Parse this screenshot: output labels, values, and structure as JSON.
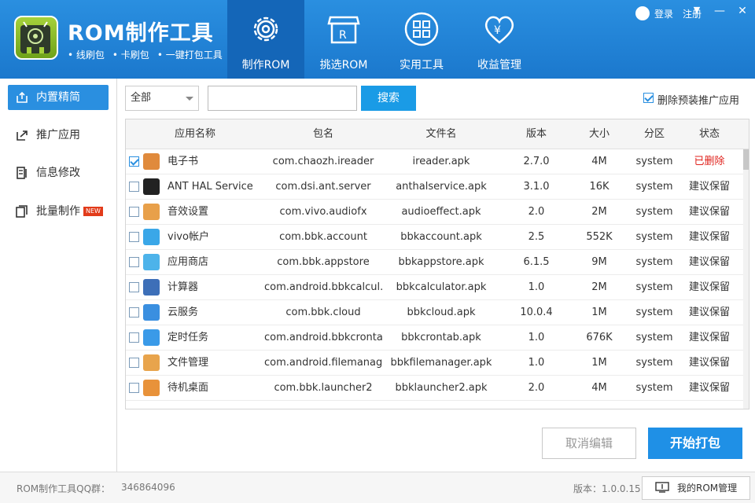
{
  "app": {
    "title": "ROM制作工具",
    "subtitle_items": [
      "• 线刷包",
      "• 卡刷包",
      "• 一键打包工具"
    ]
  },
  "nav": [
    {
      "label": "制作ROM",
      "icon": "gear-icon",
      "active": true
    },
    {
      "label": "挑选ROM",
      "icon": "shop-r-icon",
      "active": false
    },
    {
      "label": "实用工具",
      "icon": "grid-tools-icon",
      "active": false
    },
    {
      "label": "收益管理",
      "icon": "heart-yen-icon",
      "active": false
    }
  ],
  "user": {
    "login": "登录",
    "register": "注册",
    "icon": "user-icon"
  },
  "window_controls": {
    "menu": "▼",
    "minimize": "—",
    "close": "✕"
  },
  "sidebar": {
    "items": [
      {
        "label": "内置精简",
        "icon": "upload-box-icon",
        "active": true
      },
      {
        "label": "推广应用",
        "icon": "share-icon",
        "active": false
      },
      {
        "label": "信息修改",
        "icon": "edit-doc-icon",
        "active": false
      },
      {
        "label": "批量制作",
        "icon": "layers-icon",
        "active": false,
        "badge": "NEW"
      }
    ]
  },
  "toolbar": {
    "filter_value": "全部",
    "search_value": "",
    "search_label": "搜索",
    "remove_preinstalled_label": "删除预装推广应用",
    "remove_preinstalled_checked": true
  },
  "table": {
    "headers": [
      "应用名称",
      "包名",
      "文件名",
      "版本",
      "大小",
      "分区",
      "状态"
    ],
    "rows": [
      {
        "checked": true,
        "icon": "ebook-app-icon",
        "color": "#e08a3c",
        "name": "电子书",
        "package": "com.chaozh.ireader",
        "file": "ireader.apk",
        "version": "2.7.0",
        "size": "4M",
        "partition": "system",
        "status": "已删除",
        "status_color": "#e0221c"
      },
      {
        "checked": false,
        "icon": "ant-app-icon",
        "color": "#222222",
        "name": "ANT HAL Service",
        "package": "com.dsi.ant.server",
        "file": "anthalservice.apk",
        "version": "3.1.0",
        "size": "16K",
        "partition": "system",
        "status": "建议保留",
        "status_color": "#333333"
      },
      {
        "checked": false,
        "icon": "audio-app-icon",
        "color": "#e8a04a",
        "name": "音效设置",
        "package": "com.vivo.audiofx",
        "file": "audioeffect.apk",
        "version": "2.0",
        "size": "2M",
        "partition": "system",
        "status": "建议保留",
        "status_color": "#333333"
      },
      {
        "checked": false,
        "icon": "account-app-icon",
        "color": "#3aa7e8",
        "name": "vivo帐户",
        "package": "com.bbk.account",
        "file": "bbkaccount.apk",
        "version": "2.5",
        "size": "552K",
        "partition": "system",
        "status": "建议保留",
        "status_color": "#333333"
      },
      {
        "checked": false,
        "icon": "appstore-app-icon",
        "color": "#4db3ea",
        "name": "应用商店",
        "package": "com.bbk.appstore",
        "file": "bbkappstore.apk",
        "version": "6.1.5",
        "size": "9M",
        "partition": "system",
        "status": "建议保留",
        "status_color": "#333333"
      },
      {
        "checked": false,
        "icon": "calculator-app-icon",
        "color": "#3d6fb8",
        "name": "计算器",
        "package": "com.android.bbkcalcul...",
        "file": "bbkcalculator.apk",
        "version": "1.0",
        "size": "2M",
        "partition": "system",
        "status": "建议保留",
        "status_color": "#333333"
      },
      {
        "checked": false,
        "icon": "cloud-app-icon",
        "color": "#3a8fe0",
        "name": "云服务",
        "package": "com.bbk.cloud",
        "file": "bbkcloud.apk",
        "version": "10.0.4",
        "size": "1M",
        "partition": "system",
        "status": "建议保留",
        "status_color": "#333333"
      },
      {
        "checked": false,
        "icon": "clock-app-icon",
        "color": "#3a9ae8",
        "name": "定时任务",
        "package": "com.android.bbkcrontab",
        "file": "bbkcrontab.apk",
        "version": "1.0",
        "size": "676K",
        "partition": "system",
        "status": "建议保留",
        "status_color": "#333333"
      },
      {
        "checked": false,
        "icon": "folder-app-icon",
        "color": "#e8a44c",
        "name": "文件管理",
        "package": "com.android.filemanager",
        "file": "bbkfilemanager.apk",
        "version": "1.0",
        "size": "1M",
        "partition": "system",
        "status": "建议保留",
        "status_color": "#333333"
      },
      {
        "checked": false,
        "icon": "home-app-icon",
        "color": "#e8923a",
        "name": "待机桌面",
        "package": "com.bbk.launcher2",
        "file": "bbklauncher2.apk",
        "version": "2.0",
        "size": "4M",
        "partition": "system",
        "status": "建议保留",
        "status_color": "#333333"
      }
    ]
  },
  "actions": {
    "cancel_label": "取消编辑",
    "start_label": "开始打包"
  },
  "footer": {
    "qq_label": "ROM制作工具QQ群：",
    "qq_number": "346864096",
    "version": "版本：1.0.0.15",
    "my_rom_label": "我的ROM管理"
  },
  "colors": {
    "brand": "#1b78cd",
    "accent": "#1f90e6",
    "deleted": "#e0221c"
  }
}
